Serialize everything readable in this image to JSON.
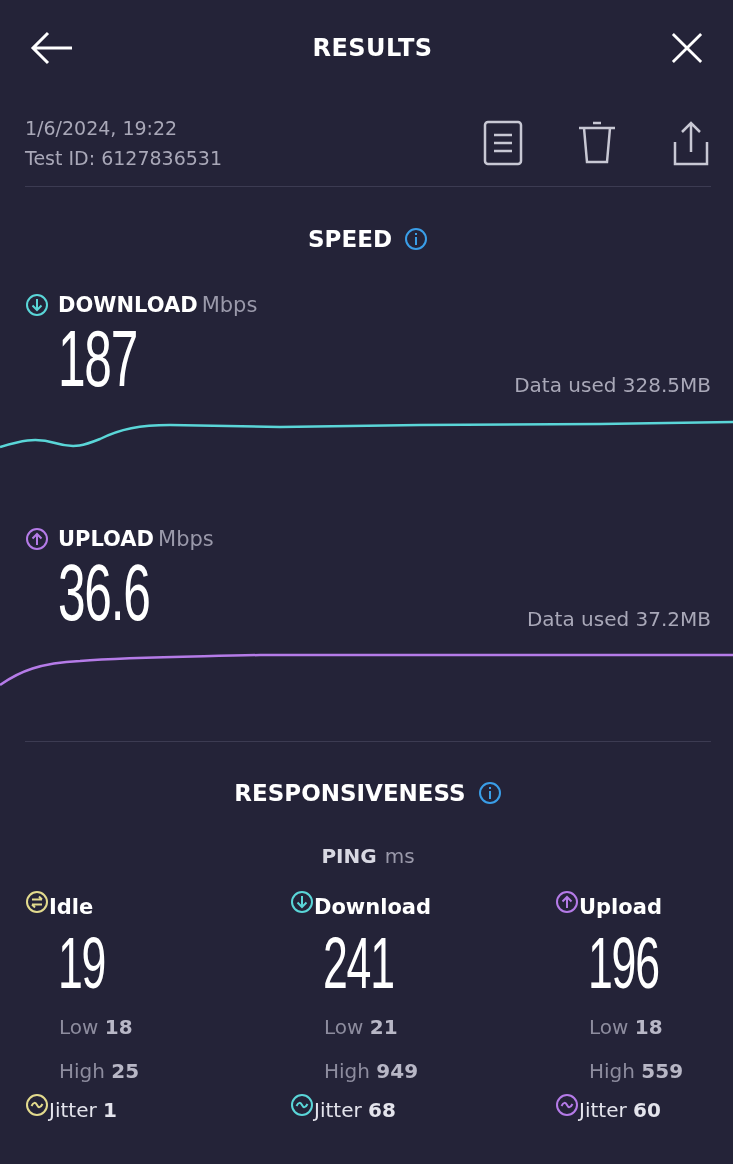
{
  "header": {
    "title": "RESULTS"
  },
  "test": {
    "date": "1/6/2024, 19:22",
    "test_id": "Test ID: 6127836531"
  },
  "speed": {
    "title": "SPEED",
    "metrics": [
      {
        "kind": "download",
        "label": "DOWNLOAD",
        "unit": "Mbps",
        "value": "187",
        "data_used": "Data used 328.5MB",
        "color": "#5ad6d8"
      },
      {
        "kind": "upload",
        "label": "UPLOAD",
        "unit": "Mbps",
        "value": "36.6",
        "data_used": "Data used 37.2MB",
        "color": "#b57be8"
      }
    ]
  },
  "responsiveness": {
    "title": "RESPONSIVENESS",
    "ping_label": "PING",
    "ping_unit": "ms",
    "columns": [
      {
        "kind": "idle",
        "label": "Idle",
        "value": "19",
        "low": "Low **18**",
        "high": "High **25**",
        "jitter": "Jitter **1**",
        "color": "#e3db8e"
      },
      {
        "kind": "download",
        "label": "Download",
        "value": "241",
        "low": "Low **21**",
        "high": "High **949**",
        "jitter": "Jitter **68**",
        "color": "#5ad6d8"
      },
      {
        "kind": "upload",
        "label": "Upload",
        "value": "196",
        "low": "Low **18**",
        "high": "High **559**",
        "jitter": "Jitter **60**",
        "color": "#b57be8"
      }
    ]
  }
}
